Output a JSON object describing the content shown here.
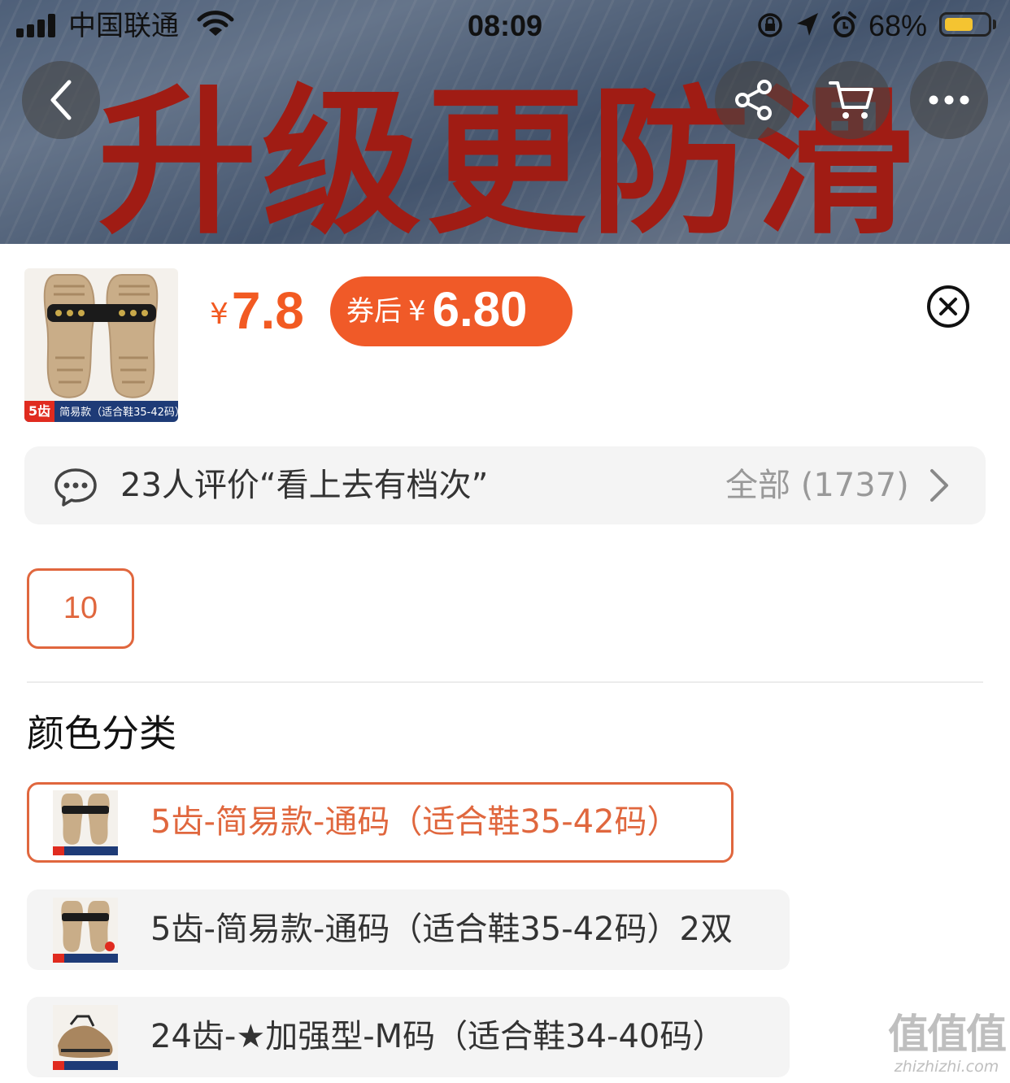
{
  "status_bar": {
    "carrier": "中国联通",
    "time": "08:09",
    "battery_percent": "68%",
    "battery_level": 0.68
  },
  "banner": {
    "headline": "升级更防滑"
  },
  "nav": {
    "back_icon": "chevron-left-icon",
    "share_icon": "share-icon",
    "cart_icon": "cart-icon",
    "more_icon": "more-icon"
  },
  "product": {
    "thumb_tag_red": "5齿",
    "thumb_tag_text": "简易款（适合鞋35-42码）",
    "price_currency": "¥",
    "price_value": "7.8",
    "coupon_label": "券后",
    "coupon_currency": "¥",
    "coupon_value": "6.80"
  },
  "review": {
    "summary": "23人评价“看上去有档次”",
    "all_label": "全部 (1737)"
  },
  "quantity": {
    "value": "10"
  },
  "section_title": "颜色分类",
  "options": [
    {
      "label": "5齿-简易款-通码（适合鞋35-42码）",
      "selected": true
    },
    {
      "label": "5齿-简易款-通码（适合鞋35-42码）2双",
      "selected": false
    },
    {
      "label": "24齿-★加强型-M码（适合鞋34-40码）",
      "selected": false
    }
  ],
  "watermark": {
    "top": "值值值",
    "bottom": "zhizhizhi.com"
  },
  "colors": {
    "accent": "#f05a28",
    "accent_border": "#e0673e",
    "banner_text": "#a01c14",
    "panel_bg": "#f4f4f4"
  }
}
